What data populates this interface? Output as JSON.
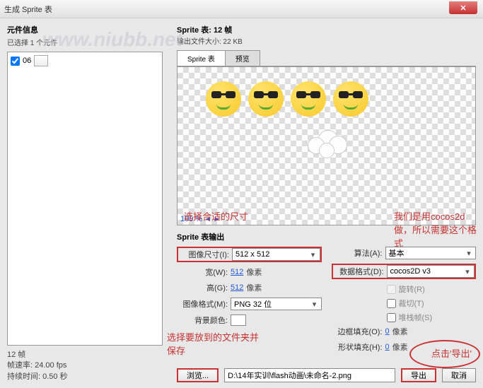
{
  "window": {
    "title": "生成 Sprite 表"
  },
  "left": {
    "heading": "元件信息",
    "selected": "已选择 1 个元件",
    "item_name": "06"
  },
  "stats": {
    "frames": "12 帧",
    "fps": "帧速率: 24.00 fps",
    "duration": "持续时间: 0.50 秒"
  },
  "right": {
    "heading": "Sprite 表: 12 帧",
    "filesize": "输出文件大小: 22 KB",
    "tab_sprite": "Sprite 表",
    "tab_preview": "预览",
    "zoom": "100 %"
  },
  "output": {
    "section_title": "Sprite 表输出",
    "image_dim_label": "图像尺寸(I):",
    "image_dim_value": "512 x 512",
    "width_label": "宽(W):",
    "width_value": "512",
    "height_label": "高(G):",
    "height_value": "512",
    "px_unit": "像素",
    "image_fmt_label": "图像格式(M):",
    "image_fmt_value": "PNG 32 位",
    "bg_label": "背景颜色:",
    "algo_label": "算法(A):",
    "algo_value": "基本",
    "data_fmt_label": "数据格式(D):",
    "data_fmt_value": "cocos2D v3",
    "rotate": "旋转(R)",
    "trim": "裁切(T)",
    "stack": "堆栈帧(S)",
    "border_label": "边框填充(O):",
    "border_value": "0",
    "shape_label": "形状填充(H):",
    "shape_value": "0"
  },
  "bottom": {
    "browse": "浏览...",
    "path": "D:\\14年实训\\flash动画\\未命名-2.png",
    "export": "导出",
    "cancel": "取消"
  },
  "annotations": {
    "choose_size": "选择合适的尺寸",
    "we_use": "我们是用cocos2d做，所以需要这个格式",
    "choose_folder": "选择要放到的文件夹并保存",
    "click_export": "点击'导出'"
  },
  "colors": {
    "annotation": "#c83232"
  }
}
